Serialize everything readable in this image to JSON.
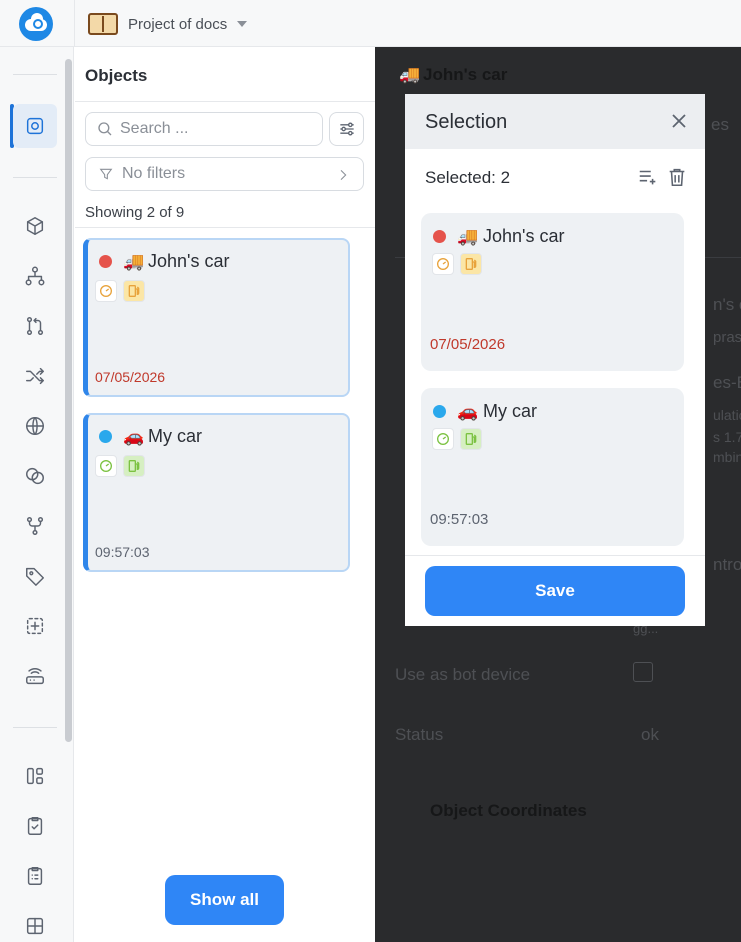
{
  "topbar": {
    "project_title": "Project of docs"
  },
  "rail": {
    "items": [
      {
        "icon": "objects-icon",
        "active": true
      },
      {
        "icon": "cube-icon"
      },
      {
        "icon": "hierarchy-icon"
      },
      {
        "icon": "git-pull-request-icon"
      },
      {
        "icon": "shuffle-icon"
      },
      {
        "icon": "globe-icon"
      },
      {
        "icon": "overlap-circles-icon"
      },
      {
        "icon": "git-fork-icon"
      },
      {
        "icon": "tag-icon"
      },
      {
        "icon": "dashed-plus-square-icon"
      },
      {
        "icon": "router-icon"
      },
      {
        "icon": "layout-icon"
      },
      {
        "icon": "clipboard-check-icon"
      },
      {
        "icon": "clipboard-list-icon"
      },
      {
        "icon": "grid-icon"
      }
    ]
  },
  "objects_panel": {
    "title": "Objects",
    "search_placeholder": "Search ...",
    "filters_label": "No filters",
    "showing": "Showing 2 of 9",
    "cards": [
      {
        "name": "John's car",
        "emoji": "🚚",
        "status_color": "#e5534b",
        "time": "07/05/2026",
        "time_color": "#c0392b",
        "badges": [
          "speedometer-icon",
          "fuel-icon"
        ],
        "badge_tint": "#e8a33c"
      },
      {
        "name": "My car",
        "emoji": "🚗",
        "status_color": "#2aa8ec",
        "time": "09:57:03",
        "time_color": "#5d6470",
        "badges": [
          "speedometer-icon",
          "fuel-icon"
        ],
        "badge_tint": "#7cc242"
      }
    ],
    "show_all_label": "Show all"
  },
  "background": {
    "header_title": "John's car",
    "header_emoji": "🚚",
    "fragments": {
      "f1": "es",
      "f2": "n's ca",
      "f3": "pras",
      "f4": "es-B",
      "f5": "ulation",
      "f6": "s 1.7",
      "f7": "mbin",
      "f8": "ntro",
      "f9": "gg...",
      "use_as_bot": "Use as bot device",
      "status_label": "Status",
      "status_value": "ok",
      "coords": "Object Coordinates"
    }
  },
  "modal": {
    "title": "Selection",
    "selected_label": "Selected: 2",
    "cards": [
      {
        "name": "John's car",
        "emoji": "🚚",
        "status_color": "#e5534b",
        "time": "07/05/2026",
        "time_color": "#c0392b",
        "badge_tint": "#e8a33c"
      },
      {
        "name": "My car",
        "emoji": "🚗",
        "status_color": "#2aa8ec",
        "time": "09:57:03",
        "time_color": "#5d6470",
        "badge_tint": "#7cc242"
      }
    ],
    "save_label": "Save"
  }
}
